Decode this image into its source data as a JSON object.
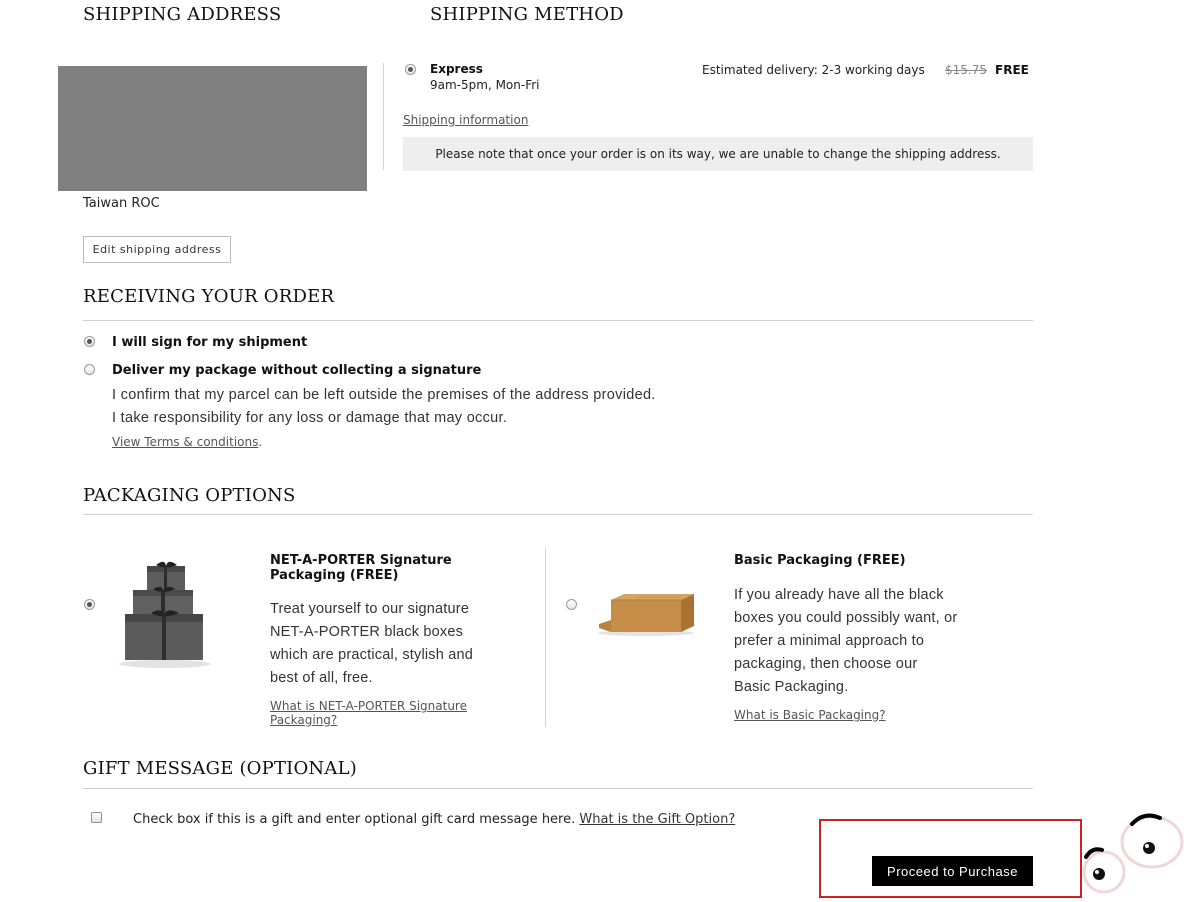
{
  "shipping_address": {
    "heading": "SHIPPING ADDRESS",
    "country": "Taiwan ROC",
    "edit_label": "Edit shipping address"
  },
  "shipping_method": {
    "heading": "SHIPPING METHOD",
    "option_name": "Express",
    "option_hours": "9am-5pm, Mon-Fri",
    "estimated": "Estimated delivery: 2-3 working days",
    "old_price": "$15.75",
    "price": "FREE",
    "info_link": "Shipping information",
    "notice": "Please note that once your order is on its way, we are unable to change the shipping address."
  },
  "receiving": {
    "heading": "RECEIVING YOUR ORDER",
    "option1": "I will sign for my shipment",
    "option2": "Deliver my package without collecting a signature",
    "option2_line1": "I confirm that my parcel can be left outside the premises of the address provided.",
    "option2_line2": "I take responsibility for any loss or damage that may occur.",
    "terms_link": "View Terms & conditions",
    "terms_suffix": "."
  },
  "packaging": {
    "heading": "PACKAGING OPTIONS",
    "signature": {
      "title_line1": "NET-A-PORTER Signature",
      "title_line2": "Packaging  (FREE)",
      "desc": [
        "Treat yourself to our signature",
        "NET-A-PORTER black boxes",
        "which are practical, stylish and",
        "best of all, free."
      ],
      "link_line1": "What is NET-A-PORTER Signature",
      "link_line2": "Packaging?"
    },
    "basic": {
      "title": "Basic Packaging  (FREE)",
      "desc": [
        "If you already have all the black",
        "boxes you could possibly want, or",
        "prefer a minimal approach to",
        "packaging, then choose our",
        "Basic Packaging."
      ],
      "link": "What is Basic Packaging?"
    }
  },
  "gift": {
    "heading": "GIFT MESSAGE (OPTIONAL)",
    "checkbox_text": "Check box if this is a gift and enter optional gift card message here.",
    "link": "What is the Gift Option?"
  },
  "proceed_label": "Proceed to Purchase",
  "colors": {
    "highlight_border": "#cc2222",
    "button_bg": "#000000",
    "notice_bg": "#eeeeee",
    "address_placeholder": "#808080"
  }
}
